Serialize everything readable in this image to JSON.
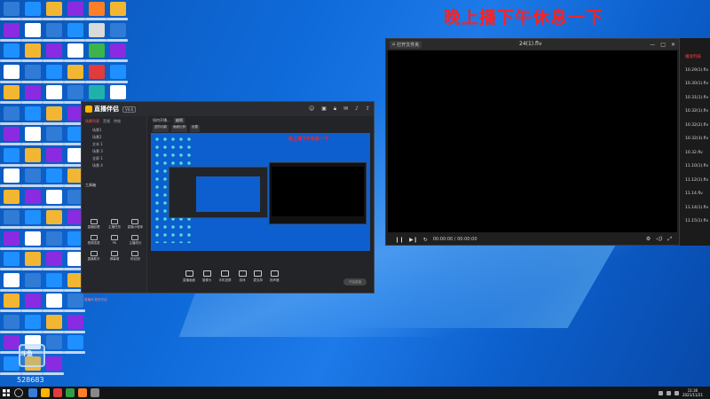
{
  "overlay_text": "晚上播下午休息一下",
  "watermark": {
    "logo_text": "斗鱼",
    "room_number": "528683"
  },
  "player": {
    "title": "24(1).flv",
    "tab_label": "打开文件夹",
    "time": "00:00:00 / 00:00:00",
    "playlist": [
      {
        "label": "播放列表",
        "active": true
      },
      {
        "label": "10.29(1).flv",
        "active": false
      },
      {
        "label": "10.30(1).flv",
        "active": false
      },
      {
        "label": "10.31(1).flv",
        "active": false
      },
      {
        "label": "10.32(1).flv",
        "active": false
      },
      {
        "label": "10.32(2).flv",
        "active": false
      },
      {
        "label": "10.32(3).flv",
        "active": false
      },
      {
        "label": "10.32.flv",
        "active": false
      },
      {
        "label": "11.10(1).flv",
        "active": false
      },
      {
        "label": "11.12(1).flv",
        "active": false
      },
      {
        "label": "11.14.flv",
        "active": false
      },
      {
        "label": "11.14(1).flv",
        "active": false
      },
      {
        "label": "11.15(1).flv",
        "active": false
      }
    ]
  },
  "obs": {
    "app_name": "直播伴侣",
    "version_badge": "V4.6",
    "tabs": [
      "场景列表",
      "音频",
      "特效"
    ],
    "scenes": [
      "场景1",
      "场景2",
      "文本 1",
      "场景 3",
      "全屏 1",
      "场景 4"
    ],
    "tools_header": "工具箱",
    "tools": [
      "直播回看",
      "主播任务",
      "直播小程序",
      "视频连麦",
      "PK",
      "主播成长",
      "直播助手",
      "弹幕墙",
      "粉丝团"
    ],
    "room_title": "如何开播...",
    "room_tag": "编辑",
    "subtabs": [
      "进阶功能",
      "画面比例",
      "设置"
    ],
    "preview_text": "晚上播下午休息一下",
    "bottom_buttons": [
      "直播画面",
      "摄像头",
      "手机投屏",
      "游戏",
      "麦克风",
      "扬声器"
    ],
    "start_button": "开始直播",
    "status_text": "直播间 暂未开启"
  },
  "taskbar": {
    "time": "11:36",
    "date": "2021/11/21"
  }
}
